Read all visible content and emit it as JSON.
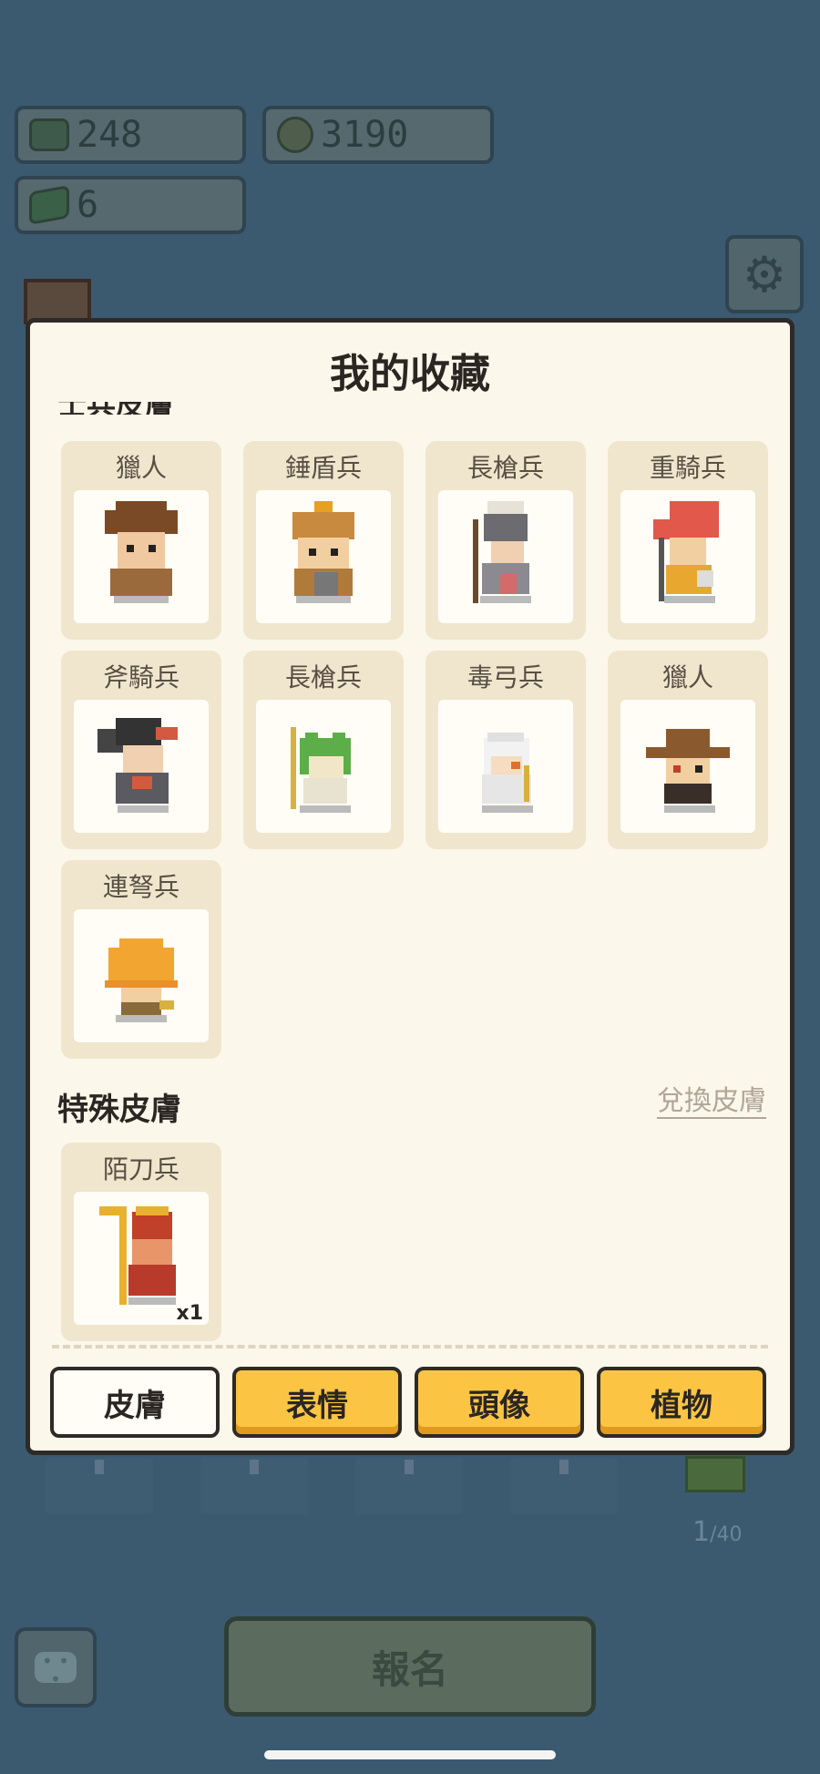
{
  "resources": {
    "food": "248",
    "coins": "3190",
    "tickets": "6"
  },
  "background": {
    "signup_label": "報名",
    "count_current": "1",
    "count_total": "/40"
  },
  "modal": {
    "title": "我的收藏",
    "cut_section_title": "士兵皮膚",
    "soldier_skins": [
      {
        "name": "獵人"
      },
      {
        "name": "錘盾兵"
      },
      {
        "name": "長槍兵"
      },
      {
        "name": "重騎兵"
      },
      {
        "name": "斧騎兵"
      },
      {
        "name": "長槍兵"
      },
      {
        "name": "毒弓兵"
      },
      {
        "name": "獵人"
      },
      {
        "name": "連弩兵"
      }
    ],
    "special_section": {
      "title": "特殊皮膚",
      "link_label": "兌換皮膚",
      "items": [
        {
          "name": "陌刀兵",
          "qty": "x1"
        }
      ]
    },
    "tabs": [
      {
        "label": "皮膚",
        "active": true
      },
      {
        "label": "表情",
        "active": false
      },
      {
        "label": "頭像",
        "active": false
      },
      {
        "label": "植物",
        "active": false
      }
    ]
  },
  "icons": [
    "food-icon",
    "coin-icon",
    "ticket-icon",
    "gear-icon",
    "chat-icon"
  ],
  "colors": {
    "background": "#3b5a70",
    "modal": "#fbf7ea",
    "card": "#efe6cd",
    "tab_yellow": "#fbc543",
    "border": "#2d2a27"
  }
}
